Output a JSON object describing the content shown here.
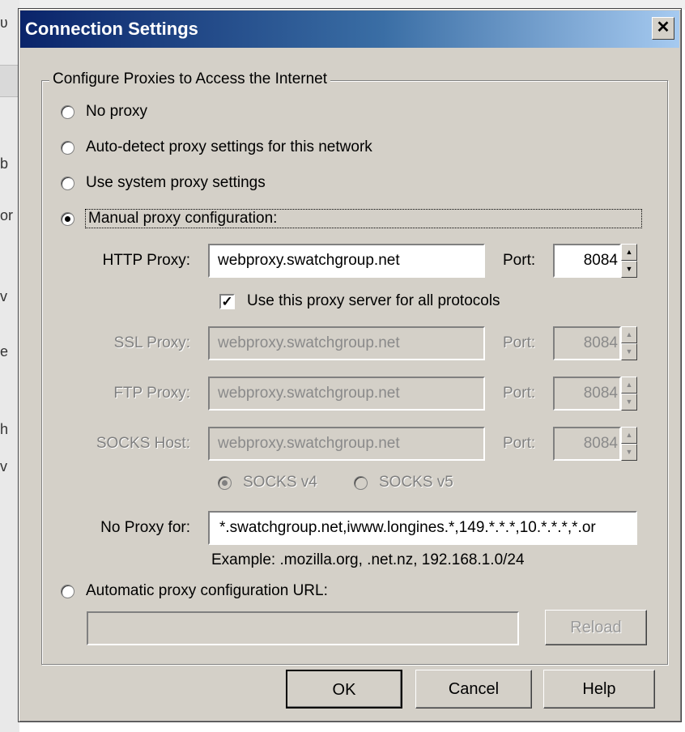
{
  "window": {
    "title": "Connection Settings",
    "close_glyph": "✕"
  },
  "background_fragments": [
    "ʋ",
    "b",
    "or",
    "v",
    "e",
    "h",
    "v"
  ],
  "group": {
    "legend": "Configure Proxies to Access the Internet"
  },
  "options": {
    "no_proxy": "No proxy",
    "auto_detect": "Auto-detect proxy settings for this network",
    "system": "Use system proxy settings",
    "manual": "Manual proxy configuration:",
    "auto_url": "Automatic proxy configuration URL:",
    "selected": "manual"
  },
  "http": {
    "label": "HTTP Proxy:",
    "value": "webproxy.swatchgroup.net",
    "port_label": "Port:",
    "port": "8084"
  },
  "use_all": {
    "label": "Use this proxy server for all protocols",
    "checked": true,
    "mark": "✓"
  },
  "ssl": {
    "label": "SSL Proxy:",
    "value": "webproxy.swatchgroup.net",
    "port_label": "Port:",
    "port": "8084"
  },
  "ftp": {
    "label": "FTP Proxy:",
    "value": "webproxy.swatchgroup.net",
    "port_label": "Port:",
    "port": "8084"
  },
  "socks": {
    "label": "SOCKS Host:",
    "value": "webproxy.swatchgroup.net",
    "port_label": "Port:",
    "port": "8084",
    "v4": "SOCKS v4",
    "v5": "SOCKS v5",
    "selected": "v4"
  },
  "no_proxy_for": {
    "label": "No Proxy for:",
    "value": "*.swatchgroup.net,iwww.longines.*,149.*.*.*,10.*.*.*,*.or",
    "example": "Example: .mozilla.org, .net.nz, 192.168.1.0/24"
  },
  "auto_url": {
    "value": "",
    "reload": "Reload"
  },
  "buttons": {
    "ok": "OK",
    "cancel": "Cancel",
    "help": "Help"
  },
  "colors": {
    "dialog_bg": "#d4d0c8",
    "title_start": "#0a246a",
    "title_end": "#a6caf0",
    "disabled_text": "#808080"
  }
}
